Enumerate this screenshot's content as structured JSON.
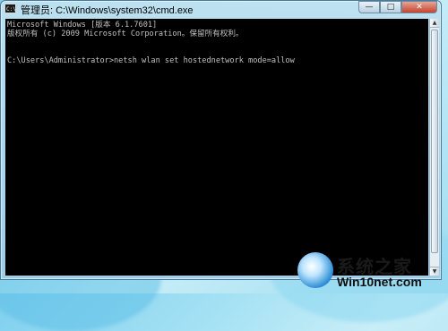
{
  "window": {
    "title": "管理员: C:\\Windows\\system32\\cmd.exe",
    "icon_text": "C:\\",
    "controls": {
      "minimize": "—",
      "maximize": "□",
      "close": "✕"
    }
  },
  "console": {
    "lines": [
      "Microsoft Windows [版本 6.1.7601]",
      "版权所有 (c) 2009 Microsoft Corporation。保留所有权利。",
      "",
      "C:\\Users\\Administrator>netsh wlan set hostednetwork mode=allow"
    ],
    "background_color": "#000000",
    "text_color": "#c0c0c0"
  },
  "watermark": {
    "brand_cn": "系统之家",
    "url": "Win10net.com"
  }
}
